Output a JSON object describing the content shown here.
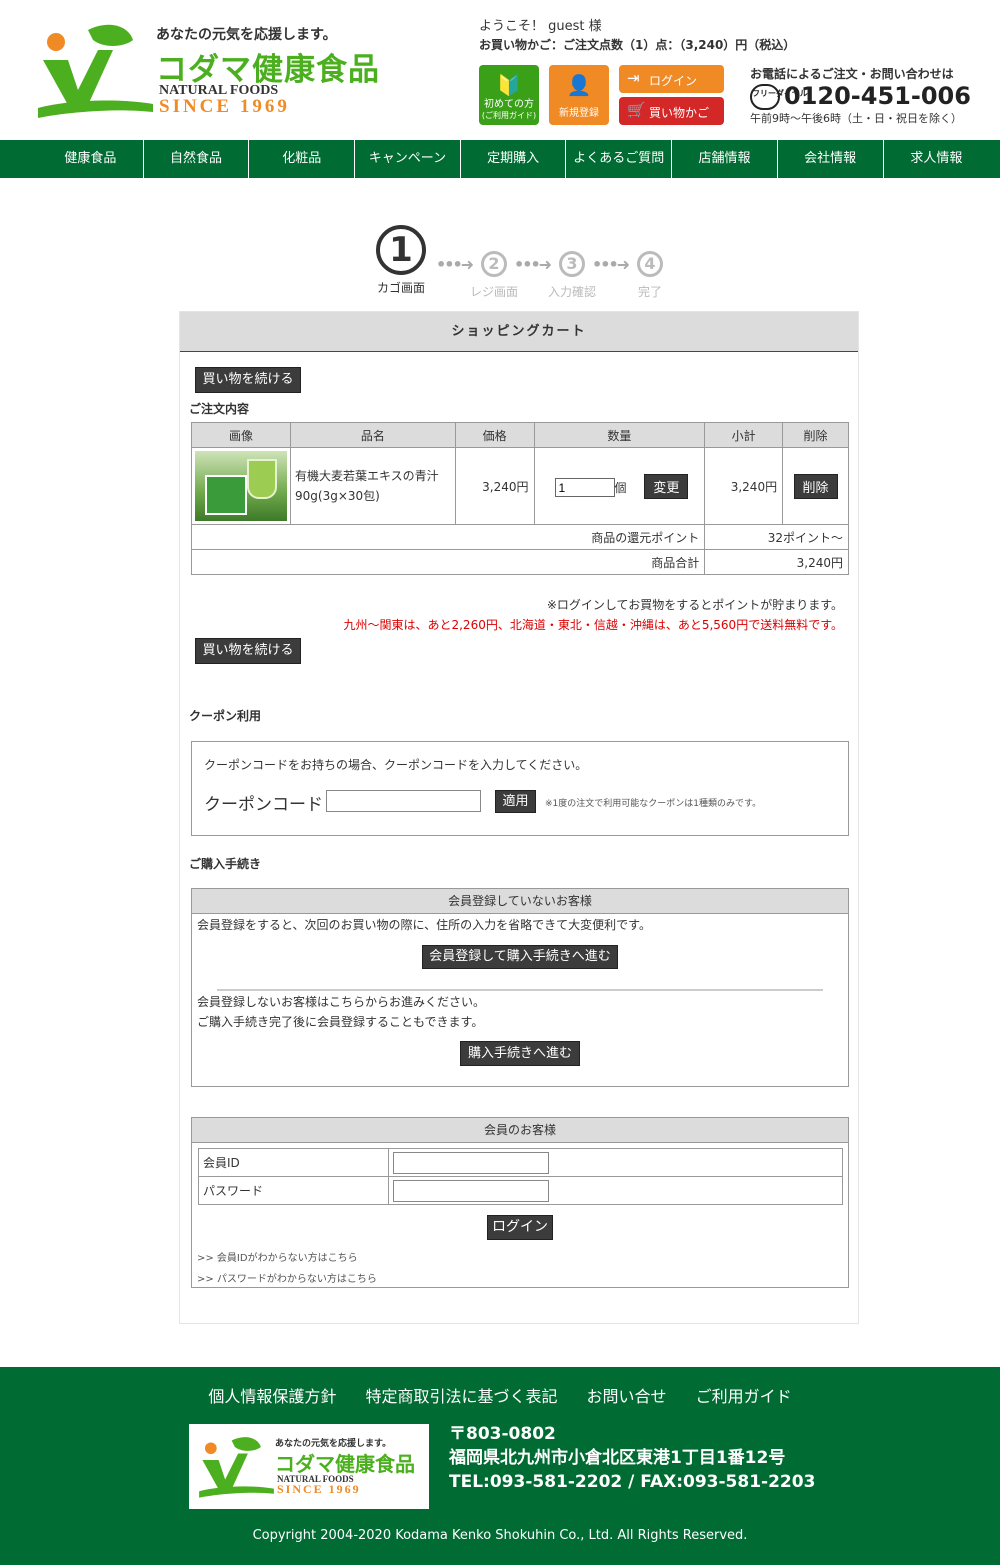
{
  "header": {
    "tagline": "あなたの元気を応援します。",
    "brand": "コダマ健康食品",
    "brand_en": "NATURAL FOODS",
    "since": "SINCE 1969",
    "welcome": "ようこそ！ guest 様",
    "cart_info": "お買い物かご：ご注文点数（1）点：（3,240）円（税込）",
    "buttons": {
      "guide": "初めての方",
      "guide_sub": "(ご利用ガイド)",
      "register": "新規登録",
      "login": "ログイン",
      "cart": "買い物かご"
    },
    "phone_title": "お電話によるご注文・お問い合わせは",
    "phone_free": "フリーダイヤル",
    "phone_number": "0120-451-006",
    "phone_hours": "午前9時〜午後6時（土・日・祝日を除く）"
  },
  "nav": [
    "健康食品",
    "自然食品",
    "化粧品",
    "キャンペーン",
    "定期購入",
    "よくあるご質問",
    "店舗情報",
    "会社情報",
    "求人情報"
  ],
  "steps": [
    {
      "num": "1",
      "label": "カゴ画面",
      "active": true
    },
    {
      "num": "2",
      "label": "レジ画面",
      "active": false
    },
    {
      "num": "3",
      "label": "入力確認",
      "active": false
    },
    {
      "num": "4",
      "label": "完了",
      "active": false
    }
  ],
  "cart": {
    "title": "ショッピングカート",
    "continue_label": "買い物を続ける",
    "order_label": "ご注文内容",
    "columns": [
      "画像",
      "品名",
      "価格",
      "数量",
      "小計",
      "削除"
    ],
    "item": {
      "name_line1": "有機大麦若葉エキスの青汁",
      "name_line2": "90g(3g×30包)",
      "price": "3,240円",
      "qty": "1",
      "qty_unit": "個",
      "change_label": "変更",
      "subtotal": "3,240円",
      "delete_label": "削除"
    },
    "points_label": "商品の還元ポイント",
    "points_value": "32ポイント〜",
    "total_label": "商品合計",
    "total_value": "3,240円",
    "note_login": "※ログインしてお買物をするとポイントが貯まります。",
    "note_shipping": "九州〜関東は、あと2,260円、北海道・東北・信越・沖縄は、あと5,560円で送料無料です。"
  },
  "coupon": {
    "section": "クーポン利用",
    "desc": "クーポンコードをお持ちの場合、クーポンコードを入力してください。",
    "label": "クーポンコード",
    "apply": "適用",
    "note": "※1度の注文で利用可能なクーポンは1種類のみです。"
  },
  "purchase": {
    "section": "ご購入手続き",
    "guest_head": "会員登録していないお客様",
    "guest_text": "会員登録をすると、次回のお買い物の際に、住所の入力を省略できて大変便利です。",
    "register_btn": "会員登録して購入手続きへ進む",
    "guest_text2": "会員登録しないお客様はこちらからお進みください。",
    "guest_text3": "ご購入手続き完了後に会員登録することもできます。",
    "proceed_btn": "購入手続きへ進む"
  },
  "member": {
    "head": "会員のお客様",
    "id_label": "会員ID",
    "pw_label": "パスワード",
    "login_btn": "ログイン",
    "forgot_id": ">> 会員IDがわからない方はこちら",
    "forgot_pw": ">> パスワードがわからない方はこちら"
  },
  "footer": {
    "links": [
      "個人情報保護方針",
      "特定商取引法に基づく表記",
      "お問い合せ",
      "ご利用ガイド"
    ],
    "zip": "〒803-0802",
    "address": "福岡県北九州市小倉北区東港1丁目1番12号",
    "tel": "TEL:093-581-2202 / FAX:093-581-2203",
    "copyright": "Copyright 2004-2020 Kodama Kenko Shokuhin Co., Ltd. All Rights Reserved."
  },
  "colors": {
    "brand_green": "#006b32",
    "logo_green": "#4caf1f",
    "orange": "#f08a24",
    "red": "#d42828"
  }
}
